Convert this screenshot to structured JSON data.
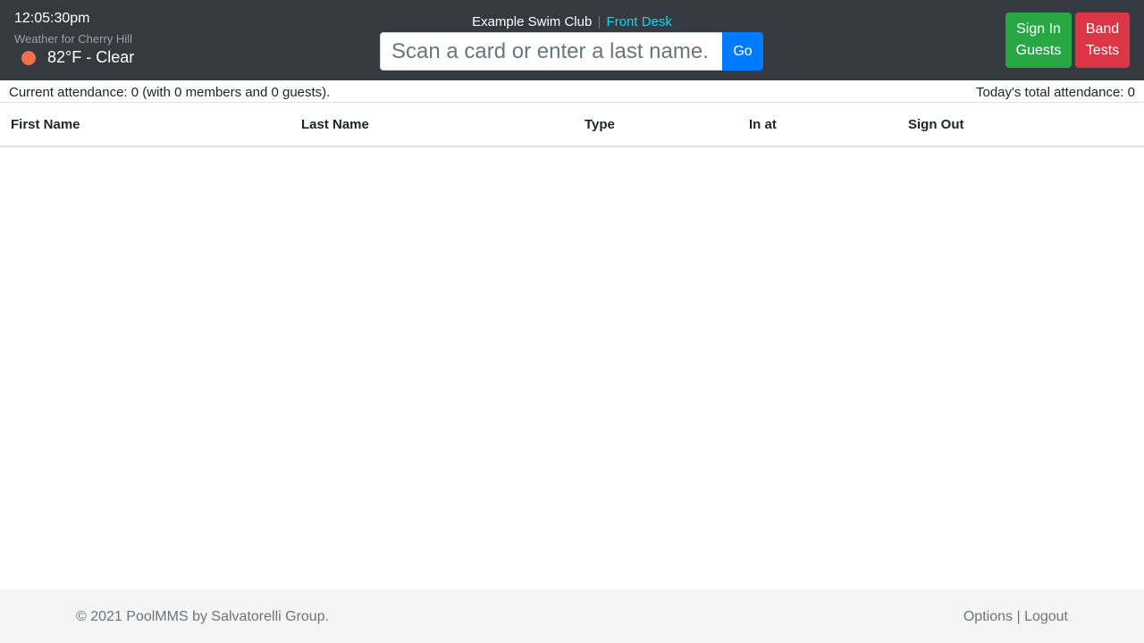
{
  "header": {
    "clock": "12:05:30pm",
    "weather_title": "Weather for Cherry Hill",
    "weather_text": "82°F - Clear",
    "weather_icon": "sun-icon",
    "club_name": "Example Swim Club",
    "separator": "|",
    "club_section": "Front Desk",
    "search_placeholder": "Scan a card or enter a last name.",
    "go_label": "Go",
    "sign_in_line1": "Sign In",
    "sign_in_line2": "Guests",
    "band_line1": "Band",
    "band_line2": "Tests"
  },
  "attendance": {
    "current": "Current attendance: 0 (with 0 members and 0 guests).",
    "total": "Today's total attendance: 0"
  },
  "table": {
    "columns": [
      "First Name",
      "Last Name",
      "Type",
      "In at",
      "Sign Out"
    ],
    "rows": []
  },
  "footer": {
    "copyright": "© 2021 PoolMMS by Salvatorelli Group.",
    "options": "Options",
    "divider": "|",
    "logout": "Logout"
  },
  "colors": {
    "topbar": "#343a40",
    "accent": "#17d6f0",
    "primary": "#007bff",
    "success": "#28a745",
    "danger": "#dc3545"
  }
}
